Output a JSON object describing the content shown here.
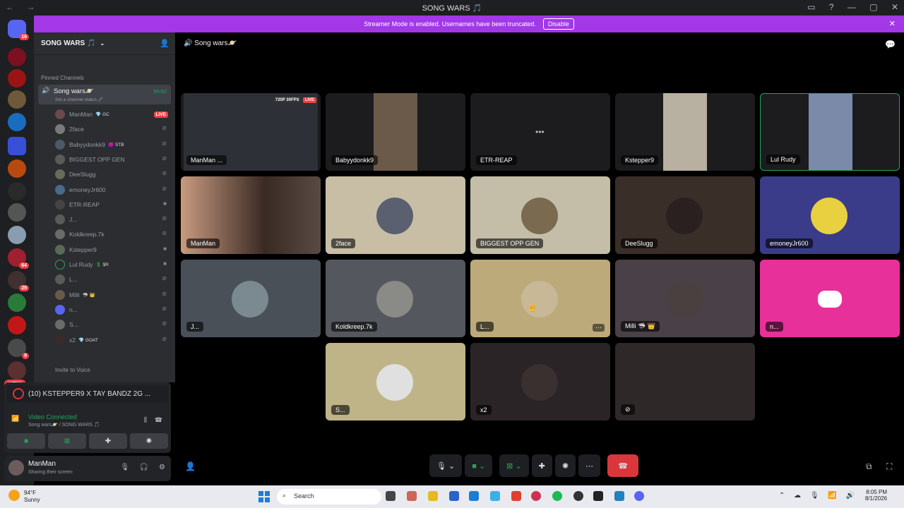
{
  "window": {
    "title": "SONG WARS 🎵",
    "back_icon": "←",
    "forward_icon": "→"
  },
  "banner": {
    "message": "Streamer Mode is enabled. Usernames have been truncated.",
    "disable_label": "Disable"
  },
  "guild_rail": {
    "badges": [
      "16",
      "64",
      "29",
      "9"
    ],
    "new_label": "NEW"
  },
  "server": {
    "name": "SONG WARS 🎵",
    "pinned_label": "Pinned Channels",
    "channel_name": "Song wars🪐",
    "channel_status": "Set a channel status 🖉",
    "channel_timer": "59:02",
    "invite_label": "Invite to Voice"
  },
  "members": [
    {
      "name": "ManMan",
      "tag": "💎 GC",
      "live": "LIVE"
    },
    {
      "name": "2face",
      "tag": ""
    },
    {
      "name": "Babyydonkk9",
      "tag": "😈 STB"
    },
    {
      "name": "BIGGEST OPP GEN",
      "tag": ""
    },
    {
      "name": "DeeSlugg",
      "tag": ""
    },
    {
      "name": "emoneyJr600",
      "tag": ""
    },
    {
      "name": "ETR-REAP",
      "tag": ""
    },
    {
      "name": "J...",
      "tag": ""
    },
    {
      "name": "Koldkreep.7k",
      "tag": ""
    },
    {
      "name": "Kstepper9",
      "tag": ""
    },
    {
      "name": "Lul Rudy",
      "tag": "💲 $R"
    },
    {
      "name": "L...",
      "tag": ""
    },
    {
      "name": "Milli",
      "tag": "🦈 👑"
    },
    {
      "name": "n...",
      "tag": ""
    },
    {
      "name": "S...",
      "tag": ""
    },
    {
      "name": "x2",
      "tag": "💎 GOAT"
    }
  ],
  "panel": {
    "stream_title": "(10) KSTEPPER9 X TAY BANDZ 2G ...",
    "voice_status": "Video Connected",
    "voice_sub": "Song wars🪐 / SONG WARS 🎵"
  },
  "user": {
    "name": "ManMan",
    "status": "Sharing their screen"
  },
  "stage": {
    "channel": "Song wars🪐"
  },
  "tiles": [
    {
      "label": "ManMan ...",
      "badge1": "720P 30FPS",
      "badge2": "LIVE"
    },
    {
      "label": "Babyydonkk9"
    },
    {
      "label": "ETR-REAP"
    },
    {
      "label": "Kstepper9"
    },
    {
      "label": "Lul Rudy"
    },
    {
      "label": "ManMan"
    },
    {
      "label": "2face"
    },
    {
      "label": "BIGGEST OPP GEN"
    },
    {
      "label": "DeeSlugg"
    },
    {
      "label": "emoneyJr600"
    },
    {
      "label": "J..."
    },
    {
      "label": "Koldkreep.7k"
    },
    {
      "label": "L..."
    },
    {
      "label": "Milli 🦈 👑"
    },
    {
      "label": "n..."
    },
    {
      "label": "S..."
    },
    {
      "label": "x2"
    },
    {
      "label": ""
    }
  ],
  "taskbar": {
    "temp": "94°F",
    "condition": "Sunny",
    "search": "Search",
    "time": "8:05 PM",
    "date": "8/1/2026"
  },
  "colors": {
    "accent": "#a238e6",
    "end_call": "#da373c",
    "connected": "#23a559",
    "live": "#ed4245",
    "discord": "#5865f2"
  }
}
